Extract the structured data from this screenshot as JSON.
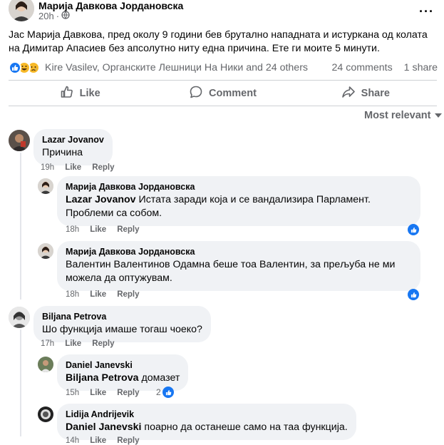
{
  "post": {
    "author": "Марија Давкова Јордановска",
    "time": "20h",
    "text": "Јас Марија Давкова, пред околу 9 години бев брутално нападната и истуркана од колата на Димитар Апасиев без апсолутно ниту една причина. Ете ги моите 5 минути.",
    "reaction_names": "Kire Vasilev, Органските Лешници На Ники and 24 others",
    "comments_count": "24 comments",
    "shares_count": "1 share"
  },
  "actions": {
    "like": "Like",
    "comment": "Comment",
    "share": "Share"
  },
  "sort_label": "Most relevant",
  "comments": [
    {
      "author": "Lazar Jovanov",
      "text": "Причина",
      "time": "19h",
      "like": "Like",
      "reply": "Reply"
    },
    {
      "author": "Марија Давкова Јордановска",
      "mention": "Lazar Jovanov",
      "text": " Истата заради која и се вандализира Парламент. Проблеми са собом.",
      "time": "18h",
      "like": "Like",
      "reply": "Reply"
    },
    {
      "author": "Марија Давкова Јордановска",
      "text": "Валентин Валентинов Одамна беше тоа Валентин, за прељуба не ми можела да оптужувам.",
      "time": "18h",
      "like": "Like",
      "reply": "Reply"
    },
    {
      "author": "Biljana Petrova",
      "text": "Шо функција имаше тогаш чоеко?",
      "time": "17h",
      "like": "Like",
      "reply": "Reply"
    },
    {
      "author": "Daniel Janevski",
      "mention": "Biljana Petrova",
      "text": " домазет",
      "time": "15h",
      "like": "Like",
      "reply": "Reply",
      "reaction_count": "2"
    },
    {
      "author": "Lidija Andrijevik",
      "mention": "Daniel Janevski",
      "text": " поарно да останеше само на таа функција.",
      "time": "14h",
      "like": "Like",
      "reply": "Reply"
    }
  ],
  "colors": {
    "accent": "#1877f2",
    "secondary_text": "#65676b",
    "bubble": "#f0f2f5"
  },
  "icons": [
    "globe-icon",
    "like-reaction-icon",
    "haha-reaction-icon",
    "sad-reaction-icon",
    "thumbs-up-icon",
    "comment-icon",
    "share-icon",
    "chevron-down-icon",
    "more-icon"
  ]
}
